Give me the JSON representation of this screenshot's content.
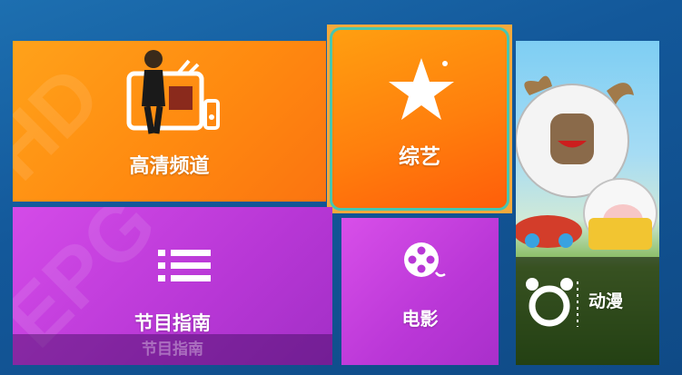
{
  "tiles": {
    "hd_channel": {
      "label": "高清频道"
    },
    "variety": {
      "label": "综艺"
    },
    "anime": {
      "label": "动漫"
    },
    "program_guide": {
      "label": "节目指南",
      "sub_label": "节目指南"
    },
    "movies": {
      "label": "电影"
    }
  },
  "watermarks": {
    "hd": "HD",
    "epg": "EPG"
  },
  "icons": {
    "hd_channel": "tv-icon",
    "variety": "star-icon",
    "program_guide": "list-icon",
    "movies": "film-reel-icon",
    "anime": "mouse-ears-icon"
  },
  "colors": {
    "orange": "#ff8a10",
    "purple": "#b837d6",
    "focus_border": "#47c6b0",
    "background": "#13589a"
  }
}
